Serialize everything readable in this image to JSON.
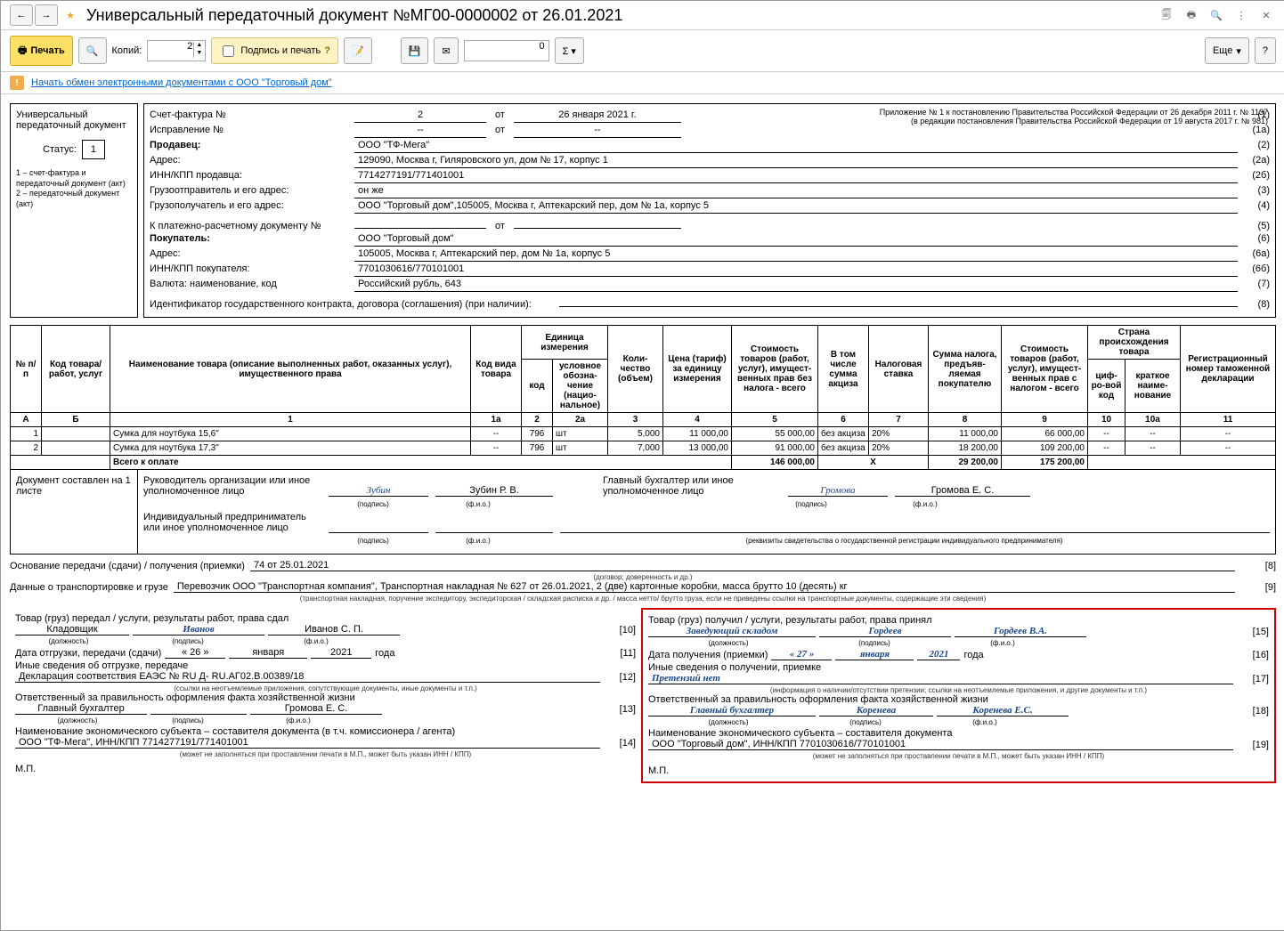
{
  "title": "Универсальный передаточный документ №МГ00-0000002 от 26.01.2021",
  "toolbar": {
    "print": "Печать",
    "copies_lbl": "Копий:",
    "copies": "2",
    "sign": "Подпись и печать",
    "zero": "0",
    "more": "Еще",
    "help": "?"
  },
  "infobar": {
    "link": "Начать обмен электронными документами с ООО \"Торговый дом\""
  },
  "leftbox": {
    "title": "Универсальный передаточный документ",
    "status_lbl": "Статус:",
    "status": "1",
    "legend": "1 – счет-фактура и передаточный документ (акт)\n2 – передаточный документ (акт)"
  },
  "appendix": {
    "l1": "Приложение № 1 к постановлению Правительства Российской Федерации от 26 декабря 2011 г. № 1137",
    "l2": "(в редакции постановления Правительства Российской Федерации от 19 августа 2017 г. № 981)"
  },
  "header": [
    {
      "lbl": "Счет-фактура №",
      "v1": "2",
      "mid": "от",
      "v2": "26 января 2021 г.",
      "code": "(1)"
    },
    {
      "lbl": "Исправление №",
      "v1": "--",
      "mid": "от",
      "v2": "--",
      "code": "(1а)"
    },
    {
      "lbl": "Продавец:",
      "v": "ООО \"ТФ-Мега\"",
      "code": "(2)",
      "bold": true
    },
    {
      "lbl": "Адрес:",
      "v": "129090, Москва г, Гиляровского ул, дом № 17, корпус 1",
      "code": "(2а)"
    },
    {
      "lbl": "ИНН/КПП продавца:",
      "v": "7714277191/771401001",
      "code": "(2б)"
    },
    {
      "lbl": "Грузоотправитель и его адрес:",
      "v": "он же",
      "code": "(3)"
    },
    {
      "lbl": "Грузополучатель и его адрес:",
      "v": "ООО \"Торговый дом\",105005, Москва г, Аптекарский пер, дом № 1а, корпус 5",
      "code": "(4)"
    },
    {
      "lbl": "К платежно-расчетному документу №",
      "v1": "",
      "mid": "от",
      "v2": "",
      "code": "(5)"
    },
    {
      "lbl": "Покупатель:",
      "v": "ООО \"Торговый дом\"",
      "code": "(6)",
      "bold": true
    },
    {
      "lbl": "Адрес:",
      "v": "105005, Москва г, Аптекарский пер, дом № 1а, корпус 5",
      "code": "(6а)"
    },
    {
      "lbl": "ИНН/КПП покупателя:",
      "v": "7701030616/770101001",
      "code": "(6б)"
    },
    {
      "lbl": "Валюта: наименование, код",
      "v": "Российский рубль, 643",
      "code": "(7)"
    },
    {
      "lbl": "Идентификатор государственного контракта, договора (соглашения) (при наличии):",
      "v": "",
      "code": "(8)",
      "wide": true
    }
  ],
  "th": {
    "no": "№ п/п",
    "code": "Код товара/ работ, услуг",
    "name": "Наименование товара (описание выполненных работ, оказанных услуг), имущественного права",
    "kind": "Код вида товара",
    "unit": "Единица измерения",
    "ucode": "код",
    "uname": "условное обозна-чение (нацио-нальное)",
    "qty": "Коли-чество (объем)",
    "price": "Цена (тариф) за единицу измерения",
    "cost_wo": "Стоимость товаров (работ, услуг), имущест-венных прав без налога - всего",
    "excise": "В том числе сумма акциза",
    "rate": "Налоговая ставка",
    "tax": "Сумма налога, предъяв-ляемая покупателю",
    "cost_w": "Стоимость товаров (работ, услуг), имущест-венных прав с налогом - всего",
    "country": "Страна происхождения товара",
    "ccode": "циф-ро-вой код",
    "cname": "краткое наиме-нование",
    "decl": "Регистрационный номер таможенной декларации"
  },
  "tcols": [
    "А",
    "Б",
    "1",
    "1а",
    "2",
    "2а",
    "3",
    "4",
    "5",
    "6",
    "7",
    "8",
    "9",
    "10",
    "10а",
    "11"
  ],
  "rows": [
    {
      "no": "1",
      "code": "",
      "name": "Сумка для ноутбука 15,6\"",
      "kind": "--",
      "ucode": "796",
      "uname": "шт",
      "qty": "5,000",
      "price": "11 000,00",
      "cost_wo": "55 000,00",
      "excise": "без акциза",
      "rate": "20%",
      "tax": "11 000,00",
      "cost_w": "66 000,00",
      "ccode": "--",
      "cname": "--",
      "decl": "--"
    },
    {
      "no": "2",
      "code": "",
      "name": "Сумка для ноутбука 17,3\"",
      "kind": "--",
      "ucode": "796",
      "uname": "шт",
      "qty": "7,000",
      "price": "13 000,00",
      "cost_wo": "91 000,00",
      "excise": "без акциза",
      "rate": "20%",
      "tax": "18 200,00",
      "cost_w": "109 200,00",
      "ccode": "--",
      "cname": "--",
      "decl": "--"
    }
  ],
  "totals": {
    "lbl": "Всего к оплате",
    "cost_wo": "146 000,00",
    "x": "Х",
    "tax": "29 200,00",
    "cost_w": "175 200,00"
  },
  "sign": {
    "pages": "Документ составлен на 1 листе",
    "head_lbl": "Руководитель организации или иное уполномоченное лицо",
    "head_sig": "Зубин",
    "head_name": "Зубин Р. В.",
    "acc_lbl": "Главный бухгалтер или иное уполномоченное лицо",
    "acc_sig": "Громова",
    "acc_name": "Громова Е. С.",
    "ip_lbl": "Индивидуальный предприниматель или иное уполномоченное лицо",
    "cap_sig": "(подпись)",
    "cap_name": "(ф.и.о.)",
    "cap_req": "(реквизиты свидетельства о государственной  регистрации индивидуального предпринимателя)"
  },
  "below": {
    "basis_lbl": "Основание передачи (сдачи) / получения (приемки)",
    "basis_v": "74 от 25.01.2021",
    "basis_code": "[8]",
    "basis_hint": "(договор; доверенность и др.)",
    "trans_lbl": "Данные о транспортировке и грузе",
    "trans_v": "Перевозчик ООО \"Транспортная компания\", Транспортная накладная № 627 от 26.01.2021, 2 (две) картонные коробки, масса брутто 10 (десять) кг",
    "trans_code": "[9]",
    "trans_hint": "(транспортная накладная, поручение экспедитору, экспедиторская / складская расписка и др. / масса нетто/ брутто груза, если не приведены ссылки на транспортные документы, содержащие эти сведения)"
  },
  "left": {
    "t": "Товар (груз) передал / услуги, результаты работ, права сдал",
    "pos": "Кладовщик",
    "sig": "Иванов",
    "name": "Иванов С. П.",
    "code10": "[10]",
    "date_lbl": "Дата отгрузки, передачи (сдачи)",
    "d": "« 26 »",
    "m": "января",
    "y": "2021",
    "yw": "года",
    "code11": "[11]",
    "other_lbl": "Иные сведения об отгрузке, передаче",
    "other_v": "Декларация соответствия ЕАЭС № RU Д- RU.АГ02.В.00389/18",
    "code12": "[12]",
    "other_hint": "(ссылки на неотъемлемые приложения, сопутствующие документы, иные документы и т.п.)",
    "resp_lbl": "Ответственный за правильность оформления факта хозяйственной жизни",
    "resp_pos": "Главный бухгалтер",
    "resp_sig": "",
    "resp_name": "Громова Е. С.",
    "code13": "[13]",
    "subj_lbl": "Наименование экономического субъекта – составителя документа (в т.ч. комиссионера / агента)",
    "subj_v": "ООО \"ТФ-Мега\", ИНН/КПП 7714277191/771401001",
    "code14": "[14]",
    "subj_hint": "(может не заполняться при проставлении печати в М.П., может быть указан ИНН / КПП)",
    "mp": "М.П."
  },
  "right": {
    "t": "Товар (груз) получил / услуги, результаты работ, права принял",
    "pos": "Заведующий складом",
    "sig": "Гордеев",
    "name": "Гордеев В.А.",
    "code15": "[15]",
    "date_lbl": "Дата получения (приемки)",
    "d": "« 27 »",
    "m": "января",
    "y": "2021",
    "yw": "года",
    "code16": "[16]",
    "other_lbl": "Иные сведения о получении, приемке",
    "other_v": "Претензий нет",
    "code17": "[17]",
    "other_hint": "(информация о наличии/отсутствии претензии; ссылки на неотъемлемые приложения, и другие  документы и т.п.)",
    "resp_lbl": "Ответственный за правильность оформления факта хозяйственной жизни",
    "resp_pos": "Главный бухгалтер",
    "resp_sig": "Коренева",
    "resp_name": "Коренева Е.С.",
    "code18": "[18]",
    "subj_lbl": "Наименование экономического субъекта – составителя документа",
    "subj_v": "ООО \"Торговый дом\", ИНН/КПП 7701030616/770101001",
    "code19": "[19]",
    "subj_hint": "(может не заполняться при проставлении печати в М.П., может быть указан ИНН / КПП)",
    "mp": "М.П."
  },
  "caps": {
    "pos": "(должность)",
    "sig": "(подпись)",
    "name": "(ф.и.о.)"
  }
}
